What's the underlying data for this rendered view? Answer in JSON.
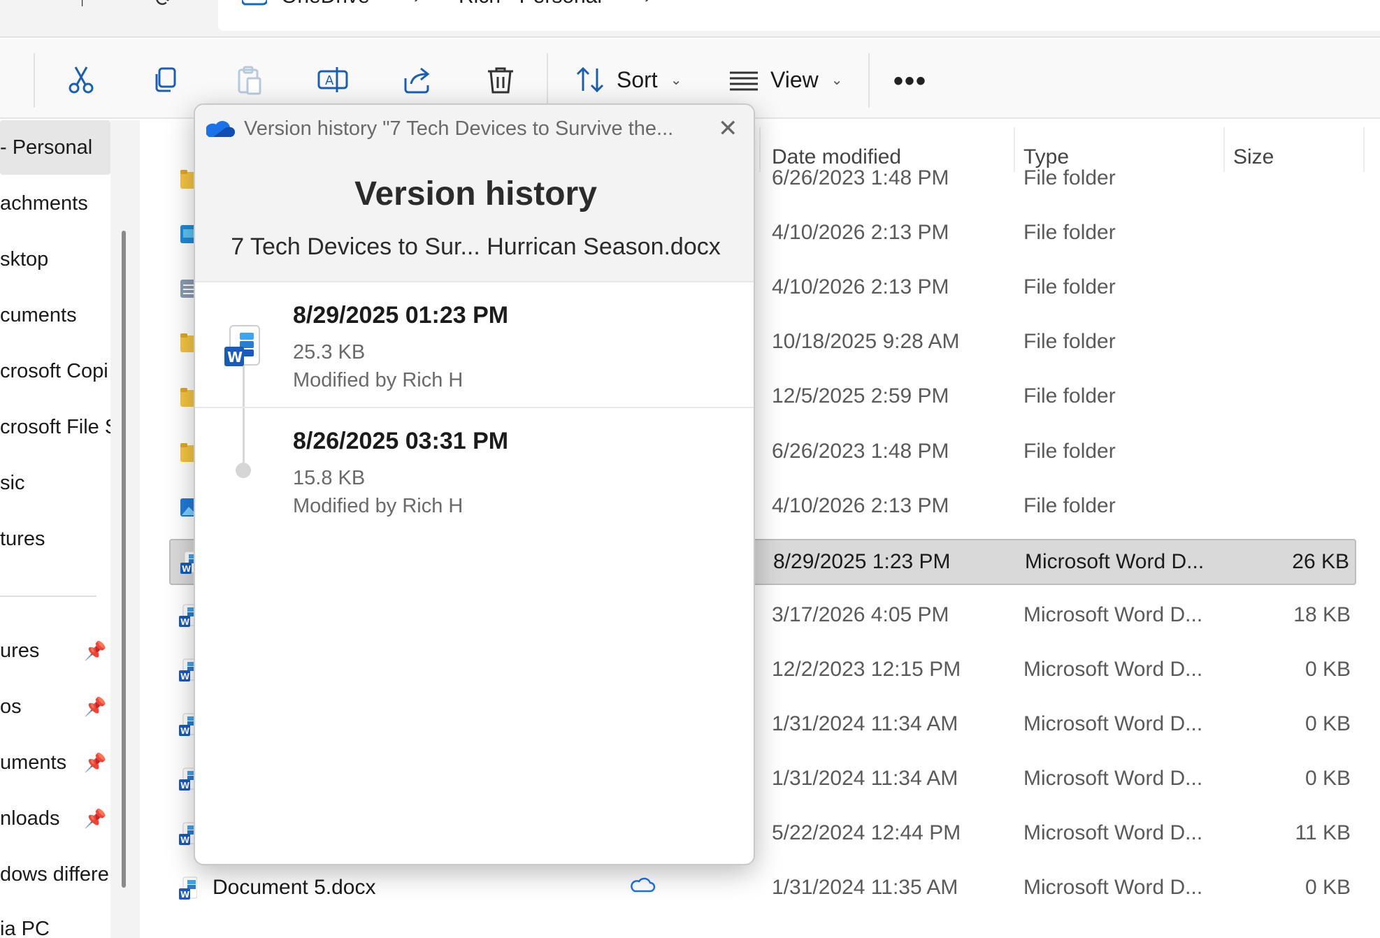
{
  "address_bar": {
    "root_label": "OneDrive",
    "location_label": "Rich - Personal"
  },
  "toolbar": {
    "cut_icon": "scissors-icon",
    "copy_icon": "copy-icon",
    "paste_icon": "clipboard-icon",
    "rename_icon": "rename-icon",
    "share_icon": "share-icon",
    "delete_icon": "trash-icon",
    "sort_label": "Sort",
    "view_label": "View",
    "more_label": "•••"
  },
  "nav": {
    "items": [
      {
        "label": "- Personal"
      },
      {
        "label": "achments"
      },
      {
        "label": "sktop"
      },
      {
        "label": "cuments"
      },
      {
        "label": "crosoft Copi"
      },
      {
        "label": "crosoft File S"
      },
      {
        "label": "sic"
      },
      {
        "label": "tures"
      }
    ],
    "pinned": [
      {
        "label": "ures"
      },
      {
        "label": "os"
      },
      {
        "label": "uments"
      },
      {
        "label": "nloads"
      },
      {
        "label": "dows differe"
      }
    ],
    "bottom_item": "ia PC"
  },
  "file_list": {
    "columns": {
      "date": "Date modified",
      "type": "Type",
      "size": "Size"
    },
    "rows": [
      {
        "icon": "folder-icon",
        "name": "",
        "date": "6/26/2023 1:48 PM",
        "type": "File folder",
        "size": ""
      },
      {
        "icon": "desktop-folder-icon",
        "name": "",
        "date": "4/10/2026 2:13 PM",
        "type": "File folder",
        "size": ""
      },
      {
        "icon": "documents-folder-icon",
        "name": "",
        "date": "4/10/2026 2:13 PM",
        "type": "File folder",
        "size": ""
      },
      {
        "icon": "folder-icon",
        "name": "",
        "date": "10/18/2025 9:28 AM",
        "type": "File folder",
        "size": ""
      },
      {
        "icon": "folder-icon",
        "name": "",
        "date": "12/5/2025 2:59 PM",
        "type": "File folder",
        "size": ""
      },
      {
        "icon": "folder-icon",
        "name": "",
        "date": "6/26/2023 1:48 PM",
        "type": "File folder",
        "size": ""
      },
      {
        "icon": "pictures-folder-icon",
        "name": "",
        "date": "4/10/2026 2:13 PM",
        "type": "File folder",
        "size": ""
      },
      {
        "icon": "word-doc-icon",
        "name": "",
        "date": "8/29/2025 1:23 PM",
        "type": "Microsoft Word D...",
        "size": "26 KB",
        "selected": true
      },
      {
        "icon": "word-doc-icon",
        "name": "",
        "date": "3/17/2026 4:05 PM",
        "type": "Microsoft Word D...",
        "size": "18 KB"
      },
      {
        "icon": "word-doc-icon",
        "name": "",
        "date": "12/2/2023 12:15 PM",
        "type": "Microsoft Word D...",
        "size": "0 KB"
      },
      {
        "icon": "word-doc-icon",
        "name": "",
        "date": "1/31/2024 11:34 AM",
        "type": "Microsoft Word D...",
        "size": "0 KB"
      },
      {
        "icon": "word-doc-icon",
        "name": "",
        "date": "1/31/2024 11:34 AM",
        "type": "Microsoft Word D...",
        "size": "0 KB"
      },
      {
        "icon": "word-doc-icon",
        "name": "",
        "date": "5/22/2024 12:44 PM",
        "type": "Microsoft Word D...",
        "size": "11 KB"
      },
      {
        "icon": "word-doc-icon",
        "name": "Document 5.docx",
        "date": "1/31/2024 11:35 AM",
        "type": "Microsoft Word D...",
        "size": "0 KB",
        "status_icon": "cloud-icon"
      }
    ]
  },
  "version_popup": {
    "caption": "Version history \"7 Tech Devices to Survive the...",
    "title": "Version history",
    "file_name": "7 Tech Devices to Sur... Hurrican Season.docx",
    "versions": [
      {
        "date": "8/29/2025 01:23 PM",
        "size": "25.3 KB",
        "modified_by": "Modified by Rich H"
      },
      {
        "date": "8/26/2025 03:31 PM",
        "size": "15.8 KB",
        "modified_by": "Modified by Rich H"
      }
    ]
  },
  "colors": {
    "accent": "#0f6cbd",
    "word_blue": "#185abd",
    "folder_yellow": "#f4c542",
    "selection_gray": "#d9d9d9"
  }
}
